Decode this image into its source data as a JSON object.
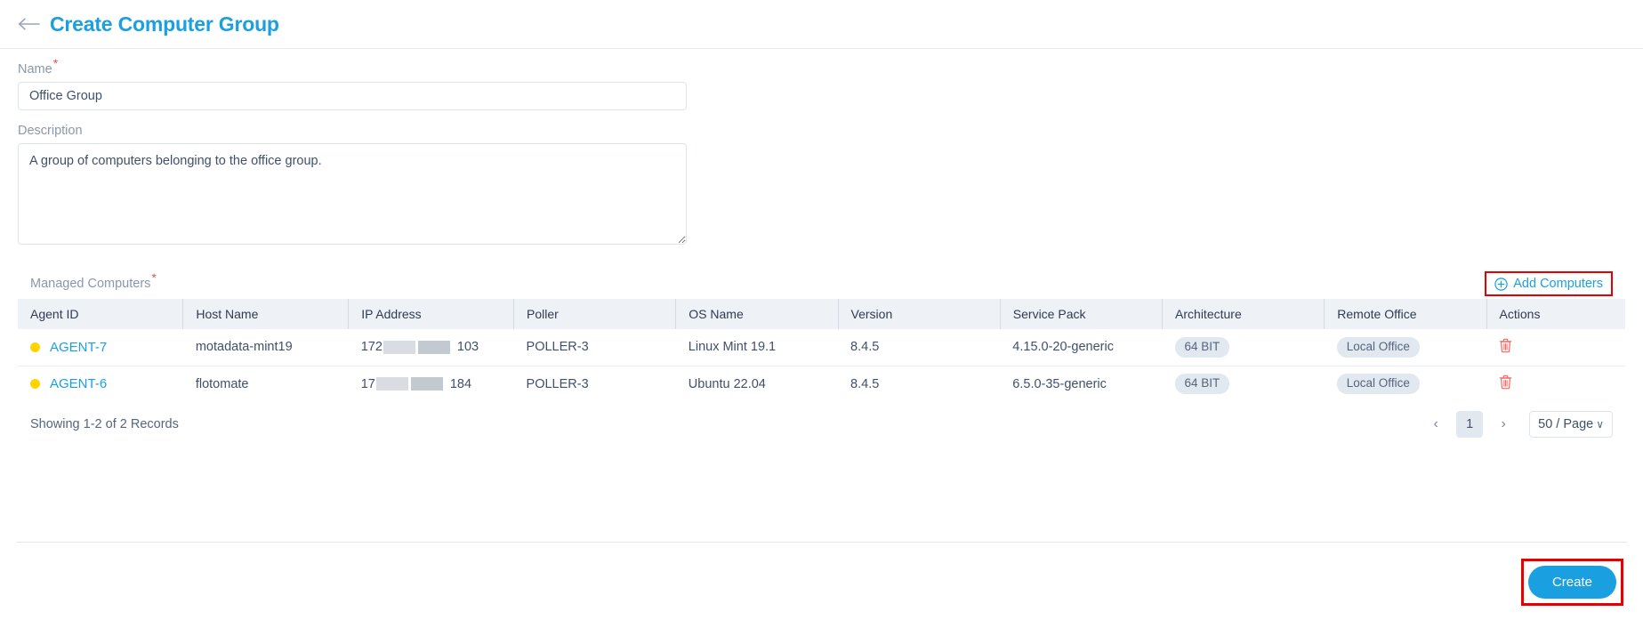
{
  "header": {
    "back_icon": "arrow-left-icon",
    "title": "Create Computer Group"
  },
  "form": {
    "name": {
      "label": "Name",
      "required_marker": "*",
      "value": "Office Group"
    },
    "description": {
      "label": "Description",
      "value": "A group of computers belonging to the office group."
    }
  },
  "managed_computers": {
    "label": "Managed Computers",
    "required_marker": "*",
    "add_button": {
      "label": "Add Computers",
      "icon": "circle-plus-icon"
    },
    "columns": [
      "Agent ID",
      "Host Name",
      "IP Address",
      "Poller",
      "OS Name",
      "Version",
      "Service Pack",
      "Architecture",
      "Remote Office",
      "Actions"
    ],
    "rows": [
      {
        "status": "yellow",
        "agent_id": "AGENT-7",
        "host_name": "motadata-mint19",
        "ip_prefix": "172",
        "ip_suffix": "103",
        "poller": "POLLER-3",
        "os_name": "Linux Mint 19.1",
        "version": "8.4.5",
        "service_pack": "4.15.0-20-generic",
        "architecture": "64 BIT",
        "remote_office": "Local Office",
        "action_icon": "trash-icon"
      },
      {
        "status": "yellow",
        "agent_id": "AGENT-6",
        "host_name": "flotomate",
        "ip_prefix": "17",
        "ip_suffix": "184",
        "poller": "POLLER-3",
        "os_name": "Ubuntu 22.04",
        "version": "8.4.5",
        "service_pack": "6.5.0-35-generic",
        "architecture": "64 BIT",
        "remote_office": "Local Office",
        "action_icon": "trash-icon"
      }
    ],
    "footer": {
      "records_text": "Showing 1-2 of 2 Records",
      "prev_label": "‹",
      "page_number": "1",
      "next_label": "›",
      "page_size": "50 / Page",
      "page_size_caret": "∨"
    }
  },
  "actions": {
    "create_label": "Create"
  },
  "colors": {
    "accent_blue": "#1a9fe0",
    "status_yellow": "#ffd400",
    "required_red": "#f05050",
    "annotation_red": "#e60000",
    "trash_red": "#f4685f",
    "header_bg": "#eef2f7",
    "pill_bg": "#e2e8f0"
  }
}
